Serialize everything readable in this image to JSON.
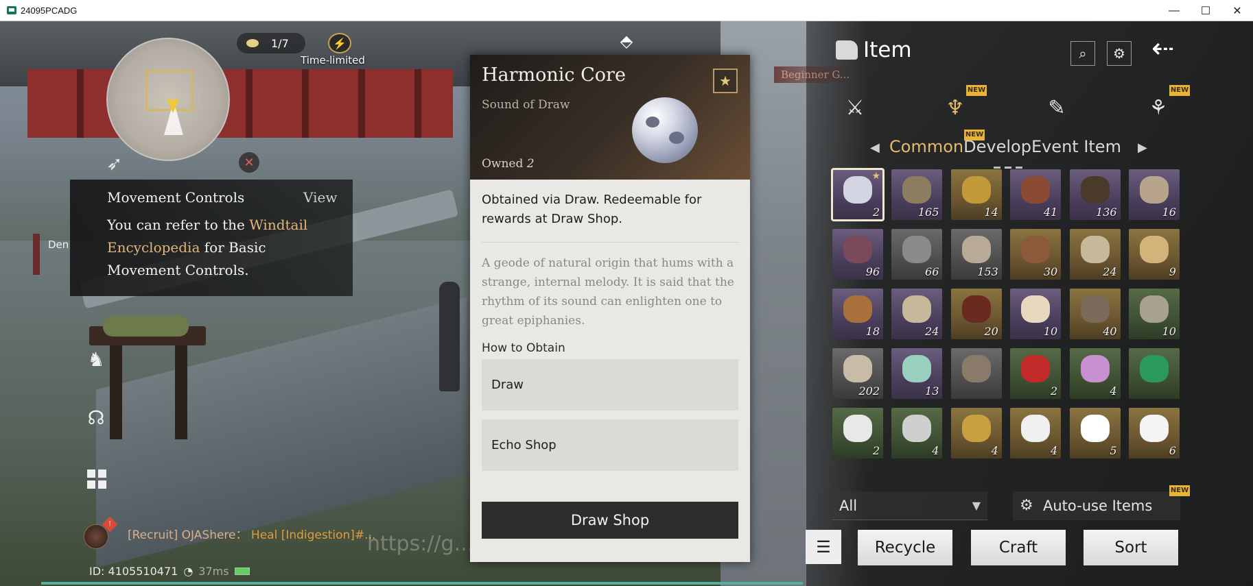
{
  "window": {
    "title": "24095PCADG",
    "min": "—",
    "max": "☐",
    "close": "✕"
  },
  "hud": {
    "counter": "1/7",
    "time_limited": "Time-limited",
    "den_label": "Den",
    "movement_tip": {
      "title": "Movement Controls",
      "view": "View",
      "body_pre": "You can refer to the ",
      "body_highlight": "Windtail Encyclopedia",
      "body_post": " for Basic Movement Controls."
    },
    "chat": {
      "badge": "!",
      "sender": "[Recruit] OJAShere：",
      "message": "Heal [Indigestion]#..."
    },
    "watermark": "https://g...   ...m/... ..llc/Game..ew",
    "status": {
      "id": "ID: 4105510471",
      "ping": "37ms"
    }
  },
  "detail": {
    "name": "Harmonic Core",
    "subtitle": "Sound of Draw",
    "owned_label": "Owned",
    "owned_value": "2",
    "obtained": "Obtained via Draw. Redeemable for rewards at Draw Shop.",
    "description": "A geode of natural origin that hums with a strange, internal melody. It is said that the rhythm of its sound can enlighten one to great epiphanies.",
    "how_to_obtain": "How to Obtain",
    "sources": [
      "Draw",
      "Echo Shop"
    ],
    "button": "Draw Shop"
  },
  "inventory": {
    "title": "Item",
    "beginner_tag": "Beginner G...",
    "new_badge": "NEW",
    "tabs": [
      {
        "label": "Common",
        "active": true
      },
      {
        "label": "Develop",
        "active": false,
        "new": true
      },
      {
        "label": "Event Item",
        "active": false
      }
    ],
    "items": [
      {
        "count": "2",
        "rarity": "purple",
        "color": "#d3d5e2",
        "fav": true,
        "selected": true
      },
      {
        "count": "165",
        "rarity": "purple",
        "color": "#8c7d60"
      },
      {
        "count": "14",
        "rarity": "gold",
        "color": "#c29a3a"
      },
      {
        "count": "41",
        "rarity": "purple",
        "color": "#8a4a34"
      },
      {
        "count": "136",
        "rarity": "purple",
        "color": "#4a3a2a"
      },
      {
        "count": "16",
        "rarity": "purple",
        "color": "#b7a48a"
      },
      {
        "count": "96",
        "rarity": "purple",
        "color": "#7a4a5a"
      },
      {
        "count": "66",
        "rarity": "grey",
        "color": "#8a8a8a"
      },
      {
        "count": "153",
        "rarity": "grey",
        "color": "#b8aa96"
      },
      {
        "count": "30",
        "rarity": "gold",
        "color": "#8a5a3a"
      },
      {
        "count": "24",
        "rarity": "gold",
        "color": "#c8b89a"
      },
      {
        "count": "9",
        "rarity": "gold",
        "color": "#d2b47a"
      },
      {
        "count": "18",
        "rarity": "purple",
        "color": "#a8703a"
      },
      {
        "count": "24",
        "rarity": "purple",
        "color": "#c8b89a"
      },
      {
        "count": "20",
        "rarity": "gold",
        "color": "#6a2a20"
      },
      {
        "count": "10",
        "rarity": "purple",
        "color": "#e8d8c0"
      },
      {
        "count": "40",
        "rarity": "gold",
        "color": "#7a6a5a"
      },
      {
        "count": "10",
        "rarity": "green",
        "color": "#a8a090"
      },
      {
        "count": "202",
        "rarity": "grey",
        "color": "#c8bca8"
      },
      {
        "count": "13",
        "rarity": "purple",
        "color": "#9ad0c0"
      },
      {
        "count": "",
        "rarity": "grey",
        "color": "#8a7a6a"
      },
      {
        "count": "2",
        "rarity": "green",
        "color": "#c22a2a"
      },
      {
        "count": "4",
        "rarity": "green",
        "color": "#c890d0"
      },
      {
        "count": "",
        "rarity": "green",
        "color": "#2a9a5a"
      },
      {
        "count": "2",
        "rarity": "green",
        "color": "#e8e8e8"
      },
      {
        "count": "4",
        "rarity": "green",
        "color": "#cfcfcf"
      },
      {
        "count": "4",
        "rarity": "gold",
        "color": "#c8a040"
      },
      {
        "count": "4",
        "rarity": "gold",
        "color": "#f0f0f0"
      },
      {
        "count": "5",
        "rarity": "gold",
        "color": "#ffffff"
      },
      {
        "count": "6",
        "rarity": "gold",
        "color": "#f4f4f4"
      }
    ],
    "filter": "All",
    "auto_use": "Auto-use Items",
    "buttons": {
      "recycle": "Recycle",
      "craft": "Craft",
      "sort": "Sort"
    }
  },
  "colors": {
    "accent": "#e7b86a",
    "highlight": "#e2b57b",
    "new_badge": "#e8b339"
  }
}
